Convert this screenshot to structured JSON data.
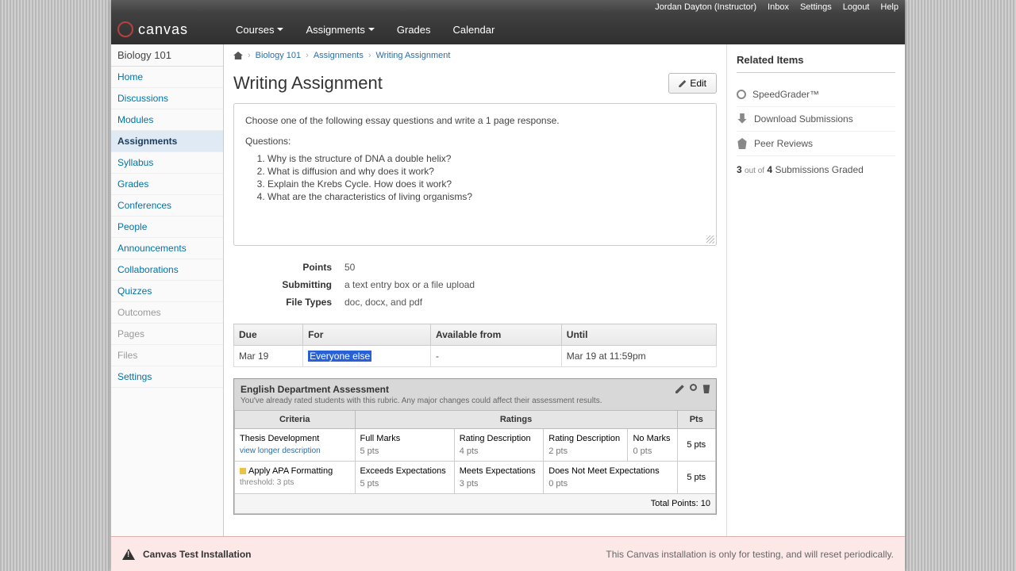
{
  "topbar": {
    "user": "Jordan Dayton (Instructor)",
    "inbox": "Inbox",
    "settings": "Settings",
    "logout": "Logout",
    "help": "Help"
  },
  "brand": "canvas",
  "nav": {
    "courses": "Courses",
    "assignments": "Assignments",
    "grades": "Grades",
    "calendar": "Calendar"
  },
  "course_name": "Biology 101",
  "sidebar": [
    "Home",
    "Discussions",
    "Modules",
    "Assignments",
    "Syllabus",
    "Grades",
    "Conferences",
    "People",
    "Announcements",
    "Collaborations",
    "Quizzes",
    "Outcomes",
    "Pages",
    "Files",
    "Settings"
  ],
  "breadcrumb": {
    "course": "Biology 101",
    "section": "Assignments",
    "page": "Writing Assignment"
  },
  "title": "Writing Assignment",
  "edit_label": "Edit",
  "description": {
    "intro": "Choose one of the following essay questions and write a 1 page response.",
    "subhead": "Questions:",
    "questions": [
      "Why is the structure of DNA a double helix?",
      "What is diffusion and why does it work?",
      "Explain the Krebs Cycle. How does it work?",
      "What are the characteristics of living organisms?"
    ]
  },
  "meta": {
    "points_label": "Points",
    "points": "50",
    "submitting_label": "Submitting",
    "submitting": "a text entry box or a file upload",
    "filetypes_label": "File Types",
    "filetypes": "doc, docx, and pdf"
  },
  "due_headers": {
    "due": "Due",
    "for": "For",
    "avail": "Available from",
    "until": "Until"
  },
  "due_row": {
    "due": "Mar 19",
    "for": "Everyone else",
    "avail": "-",
    "until": "Mar 19 at 11:59pm"
  },
  "rubric": {
    "title": "English Department Assessment",
    "note": "You've already rated students with this rubric. Any major changes could affect their assessment results.",
    "headers": {
      "criteria": "Criteria",
      "ratings": "Ratings",
      "pts": "Pts"
    },
    "rows": [
      {
        "criteria": "Thesis Development",
        "link": "view longer description",
        "ratings": [
          {
            "t": "Full Marks",
            "p": "5 pts"
          },
          {
            "t": "Rating Description",
            "p": "4 pts"
          },
          {
            "t": "Rating Description",
            "p": "2 pts"
          },
          {
            "t": "No Marks",
            "p": "0 pts"
          }
        ],
        "pts": "5 pts"
      },
      {
        "criteria": "Apply APA Formatting",
        "sub": "threshold: 3 pts",
        "ratings": [
          {
            "t": "Exceeds Expectations",
            "p": "5 pts"
          },
          {
            "t": "Meets Expectations",
            "p": "3 pts"
          },
          {
            "t": "Does Not Meet Expectations",
            "p": "0 pts"
          }
        ],
        "pts": "5 pts"
      }
    ],
    "total": "Total Points: 10"
  },
  "related": {
    "title": "Related Items",
    "items": [
      "SpeedGrader™",
      "Download Submissions",
      "Peer Reviews"
    ],
    "status_a": "3",
    "status_mid": "out of",
    "status_b": "4",
    "status_tail": "Submissions Graded"
  },
  "footer": {
    "left": "Canvas Test Installation",
    "right": "This Canvas installation is only for testing, and will reset periodically."
  }
}
